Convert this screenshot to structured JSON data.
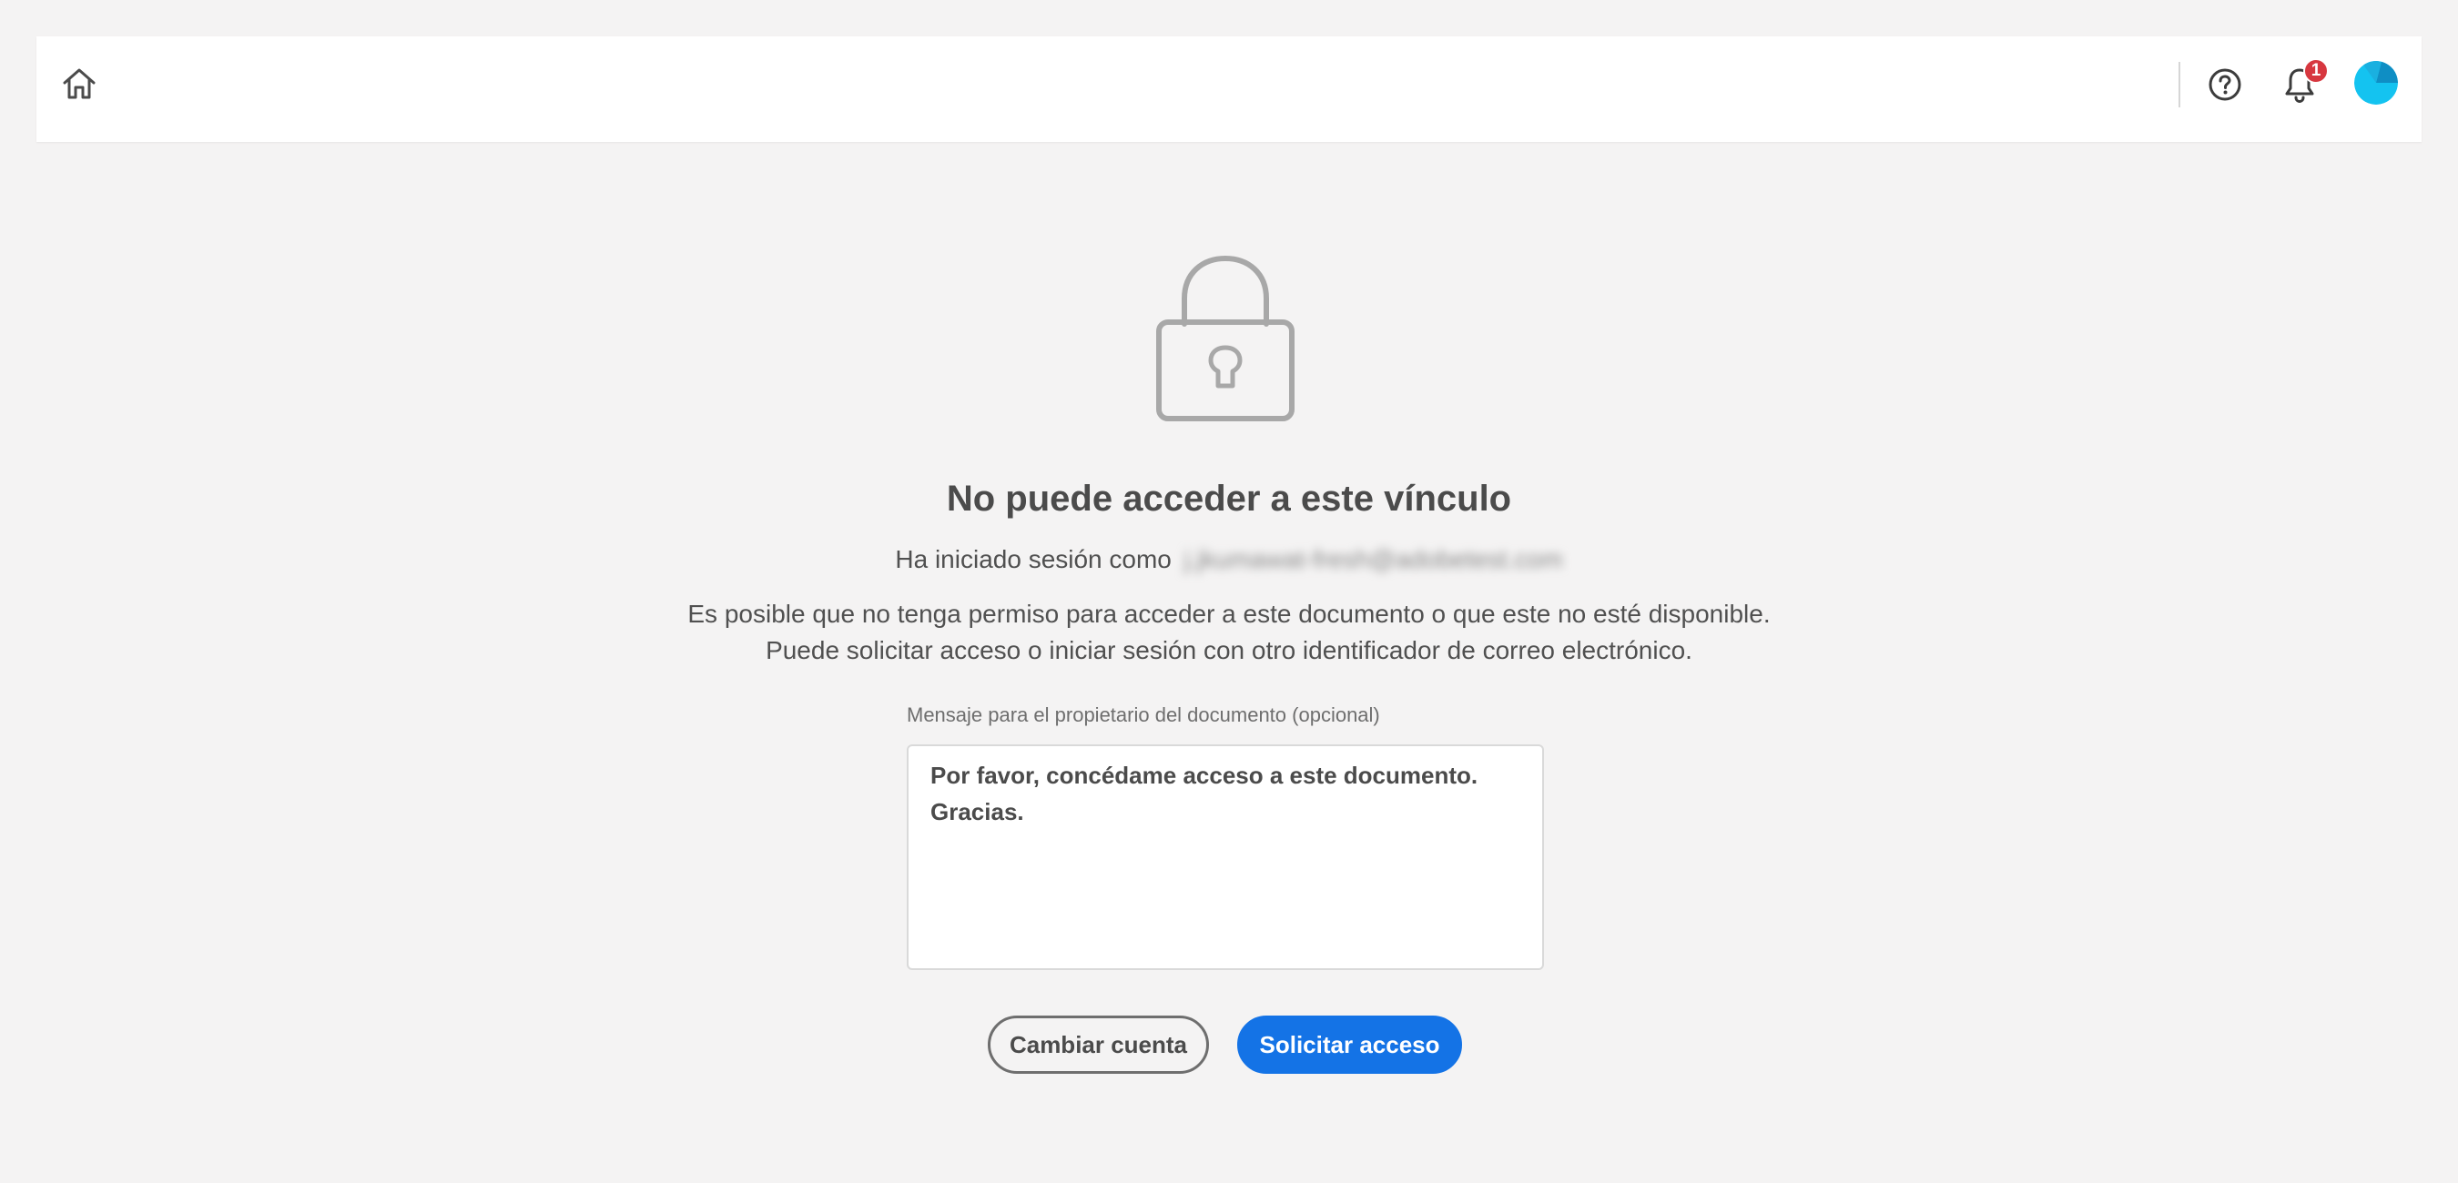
{
  "header": {
    "home_icon": "home-icon",
    "help_icon": "help-circle-icon",
    "notifications_icon": "bell-icon",
    "notification_count": "1",
    "avatar_color": "#1bb4e8"
  },
  "lock_icon": "lock-icon",
  "title": "No puede acceder a este vínculo",
  "signed_in": {
    "prefix": "Ha iniciado sesión como",
    "email": "j.jkumawat-fresh@adobetest.com"
  },
  "description": {
    "line1": "Es posible que no tenga permiso para acceder a este documento o que este no esté disponible.",
    "line2": "Puede solicitar acceso o iniciar sesión con otro identificador de correo electrónico."
  },
  "message": {
    "label": "Mensaje para el propietario del documento (opcional)",
    "value": "Por favor, concédame acceso a este documento.\nGracias."
  },
  "buttons": {
    "switch_account": "Cambiar cuenta",
    "request_access": "Solicitar acceso"
  },
  "colors": {
    "primary": "#1473e6",
    "badge": "#d7373f",
    "background": "#f4f3f3"
  }
}
